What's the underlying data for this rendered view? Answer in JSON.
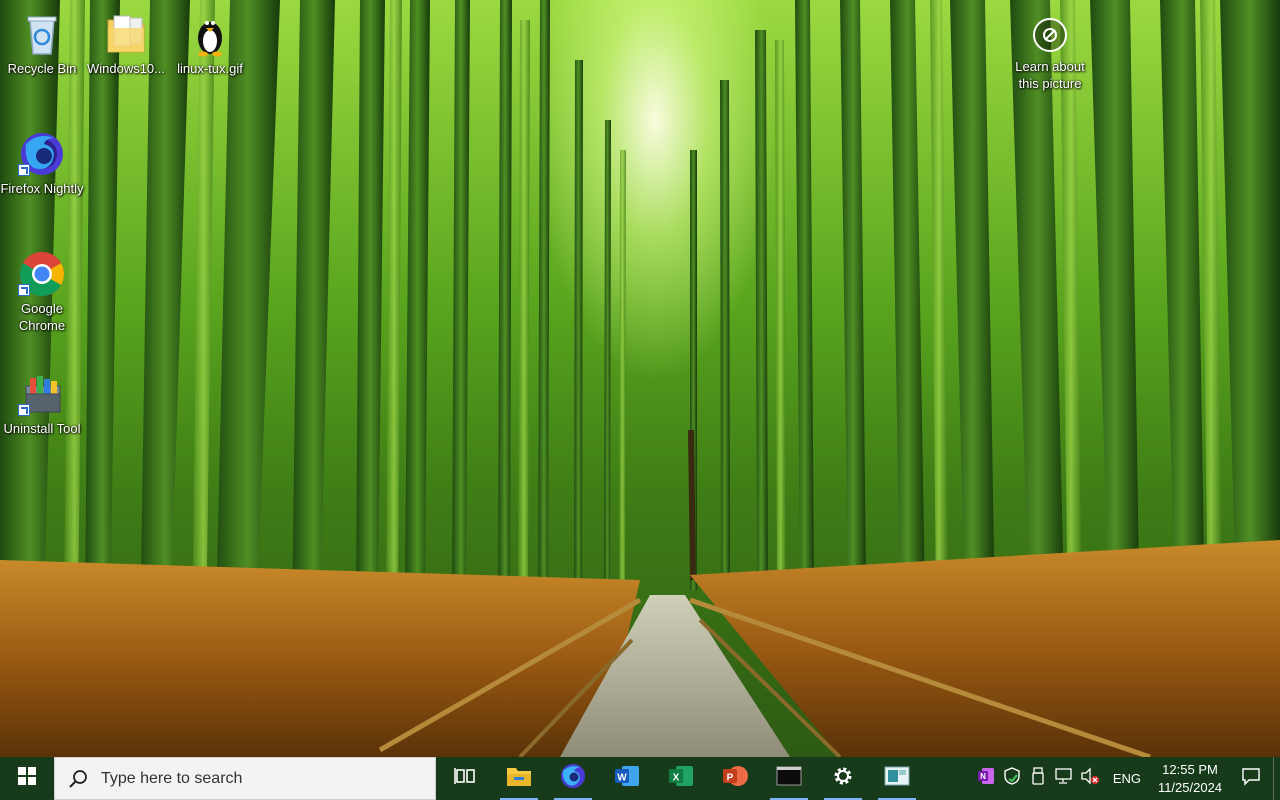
{
  "desktop": {
    "icons": [
      {
        "label": "Recycle Bin",
        "icon": "recycle-bin-icon"
      },
      {
        "label": "Windows10...",
        "icon": "folder-icon"
      },
      {
        "label": "linux-tux.gif",
        "icon": "tux-penguin-icon"
      },
      {
        "label": "Firefox Nightly",
        "icon": "firefox-nightly-icon"
      },
      {
        "label": "Google Chrome",
        "icon": "chrome-icon"
      },
      {
        "label": "Uninstall Tool",
        "icon": "uninstall-tool-icon"
      }
    ],
    "learn_about": {
      "line1": "Learn about",
      "line2": "this picture",
      "icon": "camera-circle-icon"
    }
  },
  "taskbar": {
    "search_placeholder": "Type here to search",
    "pinned_apps": [
      {
        "name": "Task View",
        "icon": "task-view-icon",
        "running": false
      },
      {
        "name": "File Explorer",
        "icon": "file-explorer-icon",
        "running": true
      },
      {
        "name": "Firefox Nightly",
        "icon": "firefox-nightly-icon",
        "running": true
      },
      {
        "name": "Word",
        "icon": "word-icon",
        "running": false
      },
      {
        "name": "Excel",
        "icon": "excel-icon",
        "running": false
      },
      {
        "name": "PowerPoint",
        "icon": "powerpoint-icon",
        "running": false
      },
      {
        "name": "Terminal",
        "icon": "terminal-icon",
        "running": true
      },
      {
        "name": "Settings",
        "icon": "settings-gear-icon",
        "running": true
      },
      {
        "name": "Photos",
        "icon": "photos-icon",
        "running": true
      }
    ],
    "tray": {
      "icons": [
        "onenote-icon",
        "windows-security-icon",
        "usb-device-icon",
        "network-icon",
        "volume-muted-icon"
      ],
      "language": "ENG",
      "time": "12:55 PM",
      "date": "11/25/2024"
    }
  },
  "colors": {
    "taskbar_bg": "#173a1a",
    "search_bg": "#f3f3f3",
    "running_indicator": "#7fb2ff"
  }
}
